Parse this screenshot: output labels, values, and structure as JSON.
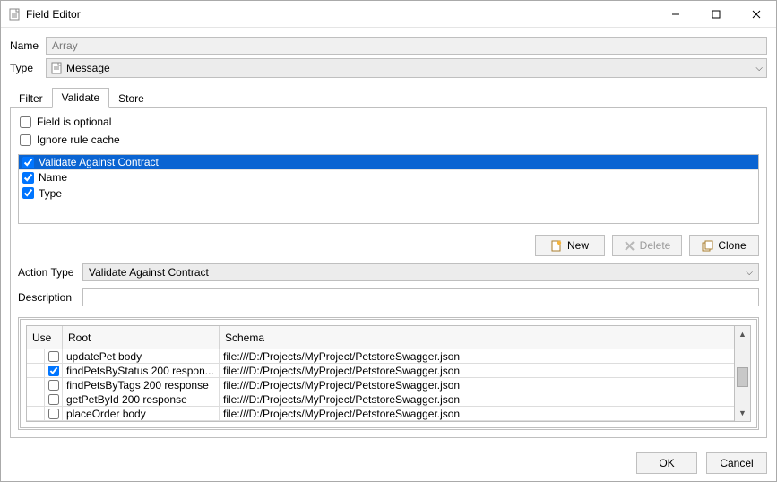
{
  "window": {
    "title": "Field Editor"
  },
  "form": {
    "name_label": "Name",
    "name_value": "Array",
    "type_label": "Type",
    "type_value": "Message"
  },
  "tabs": {
    "filter": "Filter",
    "validate": "Validate",
    "store": "Store"
  },
  "validate": {
    "field_optional_label": "Field is optional",
    "field_optional_checked": false,
    "ignore_cache_label": "Ignore rule cache",
    "ignore_cache_checked": false,
    "rules": [
      {
        "checked": true,
        "label": "Validate Against Contract",
        "selected": true
      },
      {
        "checked": true,
        "label": "Name",
        "selected": false
      },
      {
        "checked": true,
        "label": "Type",
        "selected": false
      }
    ],
    "buttons": {
      "new": "New",
      "delete": "Delete",
      "clone": "Clone"
    },
    "action_type_label": "Action Type",
    "action_type_value": "Validate Against Contract",
    "description_label": "Description",
    "description_value": ""
  },
  "contract_grid": {
    "headers": {
      "use": "Use",
      "root": "Root",
      "schema": "Schema"
    },
    "rows": [
      {
        "checked": false,
        "root": "updatePet body",
        "schema": "file:///D:/Projects/MyProject/PetstoreSwagger.json"
      },
      {
        "checked": true,
        "root": "findPetsByStatus 200 respon...",
        "schema": "file:///D:/Projects/MyProject/PetstoreSwagger.json"
      },
      {
        "checked": false,
        "root": "findPetsByTags 200 response",
        "schema": "file:///D:/Projects/MyProject/PetstoreSwagger.json"
      },
      {
        "checked": false,
        "root": "getPetById 200 response",
        "schema": "file:///D:/Projects/MyProject/PetstoreSwagger.json"
      },
      {
        "checked": false,
        "root": "placeOrder body",
        "schema": "file:///D:/Projects/MyProject/PetstoreSwagger.json"
      }
    ]
  },
  "footer": {
    "ok": "OK",
    "cancel": "Cancel"
  }
}
